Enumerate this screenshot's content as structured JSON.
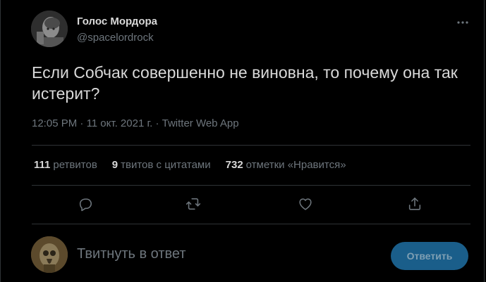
{
  "tweet": {
    "display_name": "Голос Мордора",
    "handle": "@spacelordrock",
    "text": "Если Собчак совершенно не виновна, то почему она так истерит?",
    "time": "12:05 PM",
    "date": "11 окт. 2021 г.",
    "separator": "·",
    "source": "Twitter Web App"
  },
  "stats": [
    {
      "count": "111",
      "label": "ретвитов"
    },
    {
      "count": "9",
      "label": "твитов с цитатами"
    },
    {
      "count": "732",
      "label": "отметки «Нравится»"
    }
  ],
  "actions": [
    {
      "icon": "reply-icon"
    },
    {
      "icon": "retweet-icon"
    },
    {
      "icon": "like-icon"
    },
    {
      "icon": "share-icon"
    }
  ],
  "reply_box": {
    "placeholder": "Твитнуть в ответ",
    "button_label": "Ответить"
  },
  "colors": {
    "background": "#000000",
    "primary_text": "#d9d9d9",
    "secondary_text": "#6e767d",
    "divider": "#2f3336",
    "accent": "#1d9bf0",
    "button_disabled": "#1a5e8a"
  }
}
